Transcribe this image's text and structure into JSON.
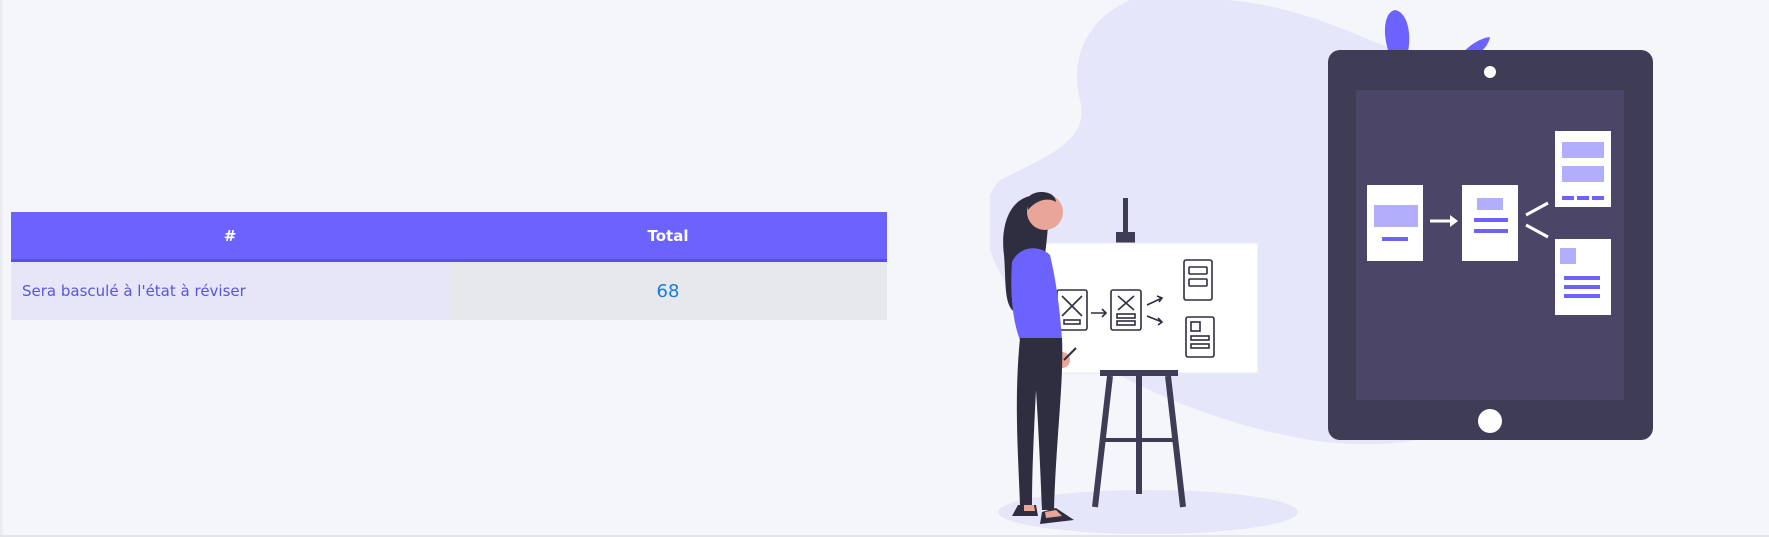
{
  "table": {
    "headers": [
      "#",
      "Total"
    ],
    "rows": [
      {
        "label": "Sera basculé à l'état à réviser",
        "value": "68"
      }
    ]
  },
  "colors": {
    "accent": "#6c63ff",
    "background": "#f5f6fa",
    "tablet": "#3f3d56",
    "value_text": "#1a7be0"
  },
  "illustration": {
    "icon": "woman-presenting-wireframes-illustration"
  }
}
